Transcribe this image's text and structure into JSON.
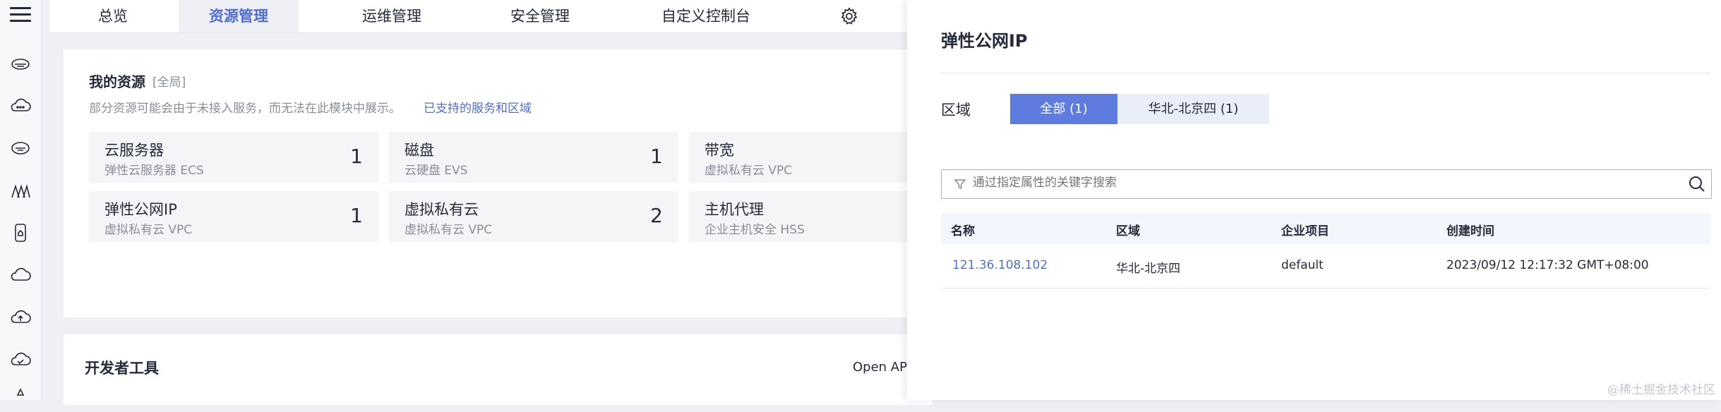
{
  "topnav": {
    "tabs": [
      {
        "label": "总览"
      },
      {
        "label": "资源管理"
      },
      {
        "label": "运维管理"
      },
      {
        "label": "安全管理"
      },
      {
        "label": "自定义控制台"
      }
    ],
    "active_tab": "资源管理"
  },
  "rail": {
    "icons": [
      "cloud-server-icon",
      "cloud-icon",
      "cloud-disk-icon",
      "network-icon",
      "phone-icon",
      "cloud-outline-icon",
      "cloud-upload-icon",
      "cloud-check-icon",
      "more-icon"
    ]
  },
  "resources": {
    "title": "我的资源",
    "scope": "[全局]",
    "note": "部分资源可能会由于未接入服务，而无法在此模块中展示。",
    "link": "已支持的服务和区域",
    "tiles": [
      {
        "name": "云服务器",
        "sub": "弹性云服务器 ECS",
        "count": "1"
      },
      {
        "name": "磁盘",
        "sub": "云硬盘 EVS",
        "count": "1"
      },
      {
        "name": "带宽",
        "sub": "虚拟私有云 VPC",
        "count": ""
      },
      {
        "name": "弹性公网IP",
        "sub": "虚拟私有云 VPC",
        "count": "1"
      },
      {
        "name": "虚拟私有云",
        "sub": "虚拟私有云 VPC",
        "count": "2"
      },
      {
        "name": "主机代理",
        "sub": "企业主机安全 HSS",
        "count": ""
      }
    ]
  },
  "devtools": {
    "title": "开发者工具",
    "api": "Open API"
  },
  "drawer": {
    "title": "弹性公网IP",
    "region_label": "区域",
    "segments": [
      {
        "label": "全部 (1)"
      },
      {
        "label": "华北-北京四 (1)"
      }
    ],
    "search_placeholder": "通过指定属性的关键字搜索",
    "columns": [
      "名称",
      "区域",
      "企业项目",
      "创建时间"
    ],
    "rows": [
      {
        "name": "121.36.108.102",
        "region": "华北-北京四",
        "project": "default",
        "created": "2023/09/12 12:17:32 GMT+08:00"
      }
    ]
  },
  "watermark": "@稀土掘金技术社区",
  "colors": {
    "accent": "#526ecc",
    "segment_active": "#5e7ce0",
    "segment_inactive": "#e9eef8"
  }
}
